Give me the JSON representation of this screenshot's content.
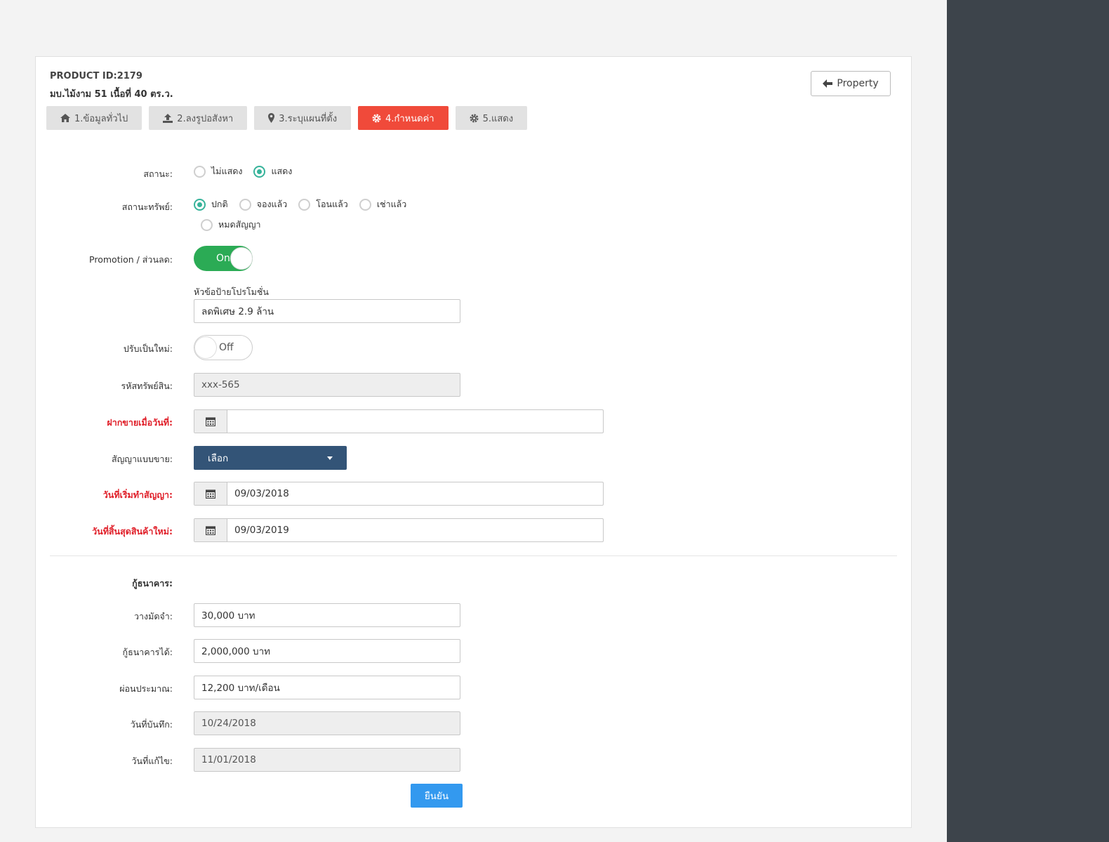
{
  "header": {
    "product_id": "PRODUCT ID:2179",
    "product_name": "มบ.ไม้งาม 51 เนื้อที่ 40 ตร.ว.",
    "back_label": "Property"
  },
  "tabs": [
    {
      "label": "1.ข้อมูลทั่วไป",
      "icon": "home-icon"
    },
    {
      "label": "2.ลงรูปอสังหา",
      "icon": "upload-icon"
    },
    {
      "label": "3.ระบุแผนที่ตั้ง",
      "icon": "map-marker-icon"
    },
    {
      "label": "4.กำหนดค่า",
      "icon": "gear-icon",
      "active": true
    },
    {
      "label": "5.แสดง",
      "icon": "gear-icon"
    }
  ],
  "form": {
    "status_label": "สถานะ:",
    "status_options": [
      {
        "label": "ไม่แสดง",
        "checked": false
      },
      {
        "label": "แสดง",
        "checked": true
      }
    ],
    "asset_status_label": "สถานะทรัพย์:",
    "asset_status_options": [
      {
        "label": "ปกติ",
        "checked": true
      },
      {
        "label": "จองแล้ว",
        "checked": false
      },
      {
        "label": "โอนแล้ว",
        "checked": false
      },
      {
        "label": "เช่าแล้ว",
        "checked": false
      },
      {
        "label": "หมดสัญญา",
        "checked": false
      }
    ],
    "promotion_label": "Promotion / ส่วนลด:",
    "promotion_toggle": "On",
    "promo_title_label": "หัวข้อป้ายโปรโมชั่น",
    "promo_title_value": "ลดพิเศษ 2.9 ล้าน",
    "renew_label": "ปรับเป็นใหม่:",
    "renew_toggle": "Off",
    "asset_code_label": "รหัสทรัพย์สิน:",
    "asset_code_value": "xxx-565",
    "consign_date_label": "ฝากขายเมื่อวันที่:",
    "consign_date_value": "",
    "contract_type_label": "สัญญาแบบขาย:",
    "contract_type_value": "เลือก",
    "contract_start_label": "วันที่เริ่มทำสัญญา:",
    "contract_start_value": "09/03/2018",
    "new_end_label": "วันที่สิ้นสุดสินค้าใหม่:",
    "new_end_value": "09/03/2019",
    "bank_loan_heading": "กู้ธนาคาร:",
    "deposit_label": "วางมัดจำ:",
    "deposit_value": "30,000 บาท",
    "loan_label": "กู้ธนาคารได้:",
    "loan_value": "2,000,000 บาท",
    "installment_label": "ผ่อนประมาณ:",
    "installment_value": "12,200 บาท/เดือน",
    "saved_date_label": "วันที่บันทึก:",
    "saved_date_value": "10/24/2018",
    "edited_date_label": "วันที่แก้ไข:",
    "edited_date_value": "11/01/2018",
    "submit_label": "ยืนยัน"
  },
  "colors": {
    "active_tab": "#f04a3a",
    "radio_checked": "#36b39a",
    "toggle_on": "#2bab55",
    "select_bg": "#335477",
    "submit_bg": "#3399ef",
    "required_label": "#e0202a",
    "sidebar_bg": "#3d444b"
  }
}
